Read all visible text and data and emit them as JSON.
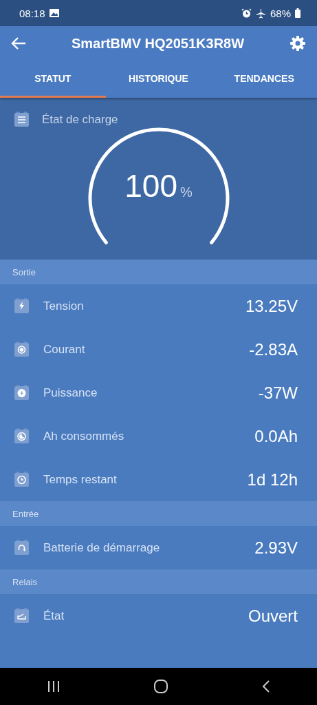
{
  "status_bar": {
    "time": "08:18",
    "battery": "68%"
  },
  "app_bar": {
    "title": "SmartBMV HQ2051K3R8W"
  },
  "tabs": [
    {
      "label": "STATUT",
      "selected": true
    },
    {
      "label": "HISTORIQUE",
      "selected": false
    },
    {
      "label": "TENDANCES",
      "selected": false
    }
  ],
  "state_of_charge": {
    "label": "État de charge",
    "value": "100",
    "unit": "%"
  },
  "sections": [
    {
      "title": "Sortie",
      "rows": [
        {
          "label": "Tension",
          "value": "13.25V"
        },
        {
          "label": "Courant",
          "value": "-2.83A"
        },
        {
          "label": "Puissance",
          "value": "-37W"
        },
        {
          "label": "Ah consommés",
          "value": "0.0Ah"
        },
        {
          "label": "Temps restant",
          "value": "1d 12h"
        }
      ]
    },
    {
      "title": "Entrée",
      "rows": [
        {
          "label": "Batterie de démarrage",
          "value": "2.93V"
        }
      ]
    },
    {
      "title": "Relais",
      "rows": [
        {
          "label": "État",
          "value": "Ouvert"
        }
      ]
    }
  ]
}
